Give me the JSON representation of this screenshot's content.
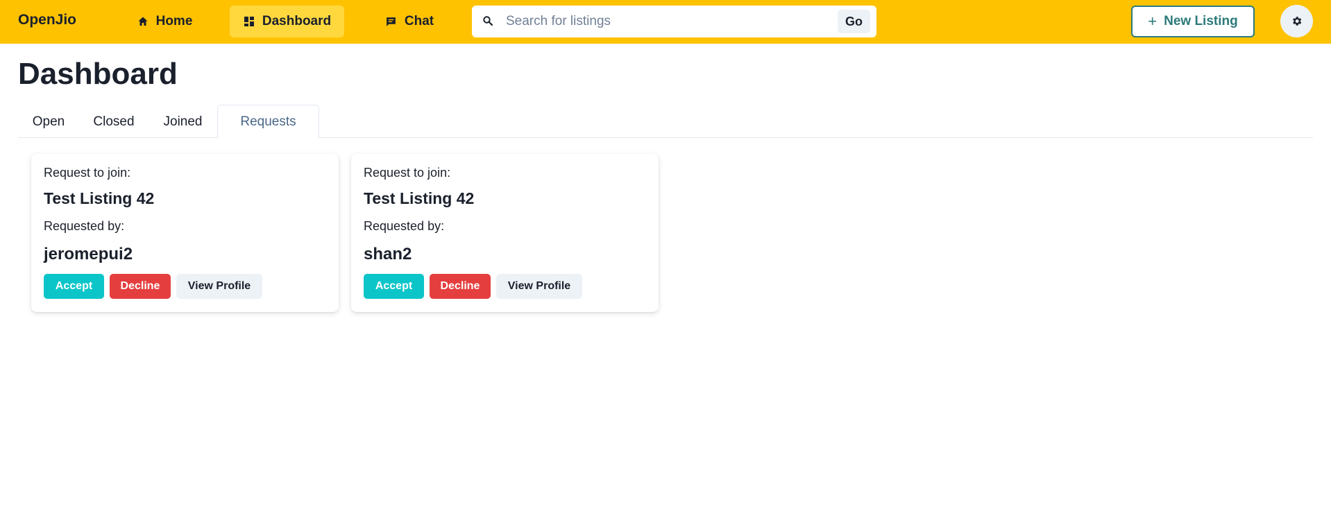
{
  "app": {
    "brand": "OpenJio"
  },
  "nav": {
    "home_label": "Home",
    "home_icon": "home-icon",
    "dashboard_label": "Dashboard",
    "dashboard_icon": "dashboard-grid-icon",
    "chat_label": "Chat",
    "chat_icon": "chat-bubble-icon",
    "active": "Dashboard"
  },
  "search": {
    "placeholder": "Search for listings",
    "value": "",
    "go_label": "Go"
  },
  "header_actions": {
    "new_listing_label": "New Listing",
    "settings_icon": "gear-icon"
  },
  "page": {
    "title": "Dashboard"
  },
  "tabs": [
    {
      "label": "Open"
    },
    {
      "label": "Closed"
    },
    {
      "label": "Joined"
    },
    {
      "label": "Requests"
    }
  ],
  "active_tab": "Requests",
  "requests": [
    {
      "request_label": "Request to join:",
      "listing_title": "Test Listing 42",
      "requested_by_label": "Requested by:",
      "username": "jeromepui2",
      "accept_label": "Accept",
      "decline_label": "Decline",
      "profile_label": "View Profile"
    },
    {
      "request_label": "Request to join:",
      "listing_title": "Test Listing 42",
      "requested_by_label": "Requested by:",
      "username": "shan2",
      "accept_label": "Accept",
      "decline_label": "Decline",
      "profile_label": "View Profile"
    }
  ],
  "colors": {
    "navbar": "#FFC201",
    "nav_active": "#FFD83D",
    "accept": "#0BC5C9",
    "decline": "#E53E3E",
    "new_listing_accent": "#2C7A7B",
    "active_tab_text": "#4A6788"
  }
}
